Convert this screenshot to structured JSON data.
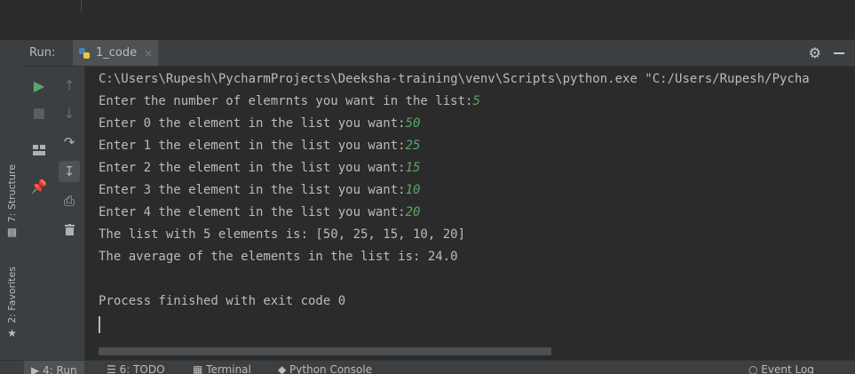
{
  "run_panel": {
    "label": "Run:",
    "tab_title": "1_code",
    "close_glyph": "×"
  },
  "left_sidebar": {
    "structure_label": "7: Structure",
    "favorites_label": "2: Favorites"
  },
  "console": {
    "lines": [
      {
        "text": "C:\\Users\\Rupesh\\PycharmProjects\\Deeksha-training\\venv\\Scripts\\python.exe \"C:/Users/Rupesh/Pycha",
        "input": ""
      },
      {
        "text": "Enter the number of elemrnts you want in the list:",
        "input": "5"
      },
      {
        "text": "Enter 0 the element in the list you want:",
        "input": "50"
      },
      {
        "text": "Enter 1 the element in the list you want:",
        "input": "25"
      },
      {
        "text": "Enter 2 the element in the list you want:",
        "input": "15"
      },
      {
        "text": "Enter 3 the element in the list you want:",
        "input": "10"
      },
      {
        "text": "Enter 4 the element in the list you want:",
        "input": "20"
      },
      {
        "text": "The list with 5 elements is: [50, 25, 15, 10, 20]",
        "input": ""
      },
      {
        "text": "The average of the elements in the list is: 24.0",
        "input": ""
      },
      {
        "text": "",
        "input": ""
      },
      {
        "text": "Process finished with exit code 0",
        "input": ""
      }
    ]
  },
  "bottom_bar": {
    "run": "4: Run",
    "todo": "6: TODO",
    "terminal": "Terminal",
    "python_console": "Python Console",
    "event_log": "Event Log"
  },
  "icons": {
    "rerun": "play-icon",
    "stop": "stop-icon",
    "up": "up-arrow-icon",
    "down": "down-arrow-icon",
    "layout": "layout-icon",
    "soft_wrap": "soft-wrap-icon",
    "scroll_to_end": "scroll-to-end-icon",
    "pin": "pin-icon",
    "print": "print-icon",
    "delete": "trash-icon",
    "settings": "gear-icon",
    "hide": "minimize-icon"
  },
  "colors": {
    "background": "#2b2b2b",
    "panel": "#3c3f41",
    "text": "#bbbbbb",
    "user_input": "#59a869",
    "run_green": "#59a869"
  }
}
